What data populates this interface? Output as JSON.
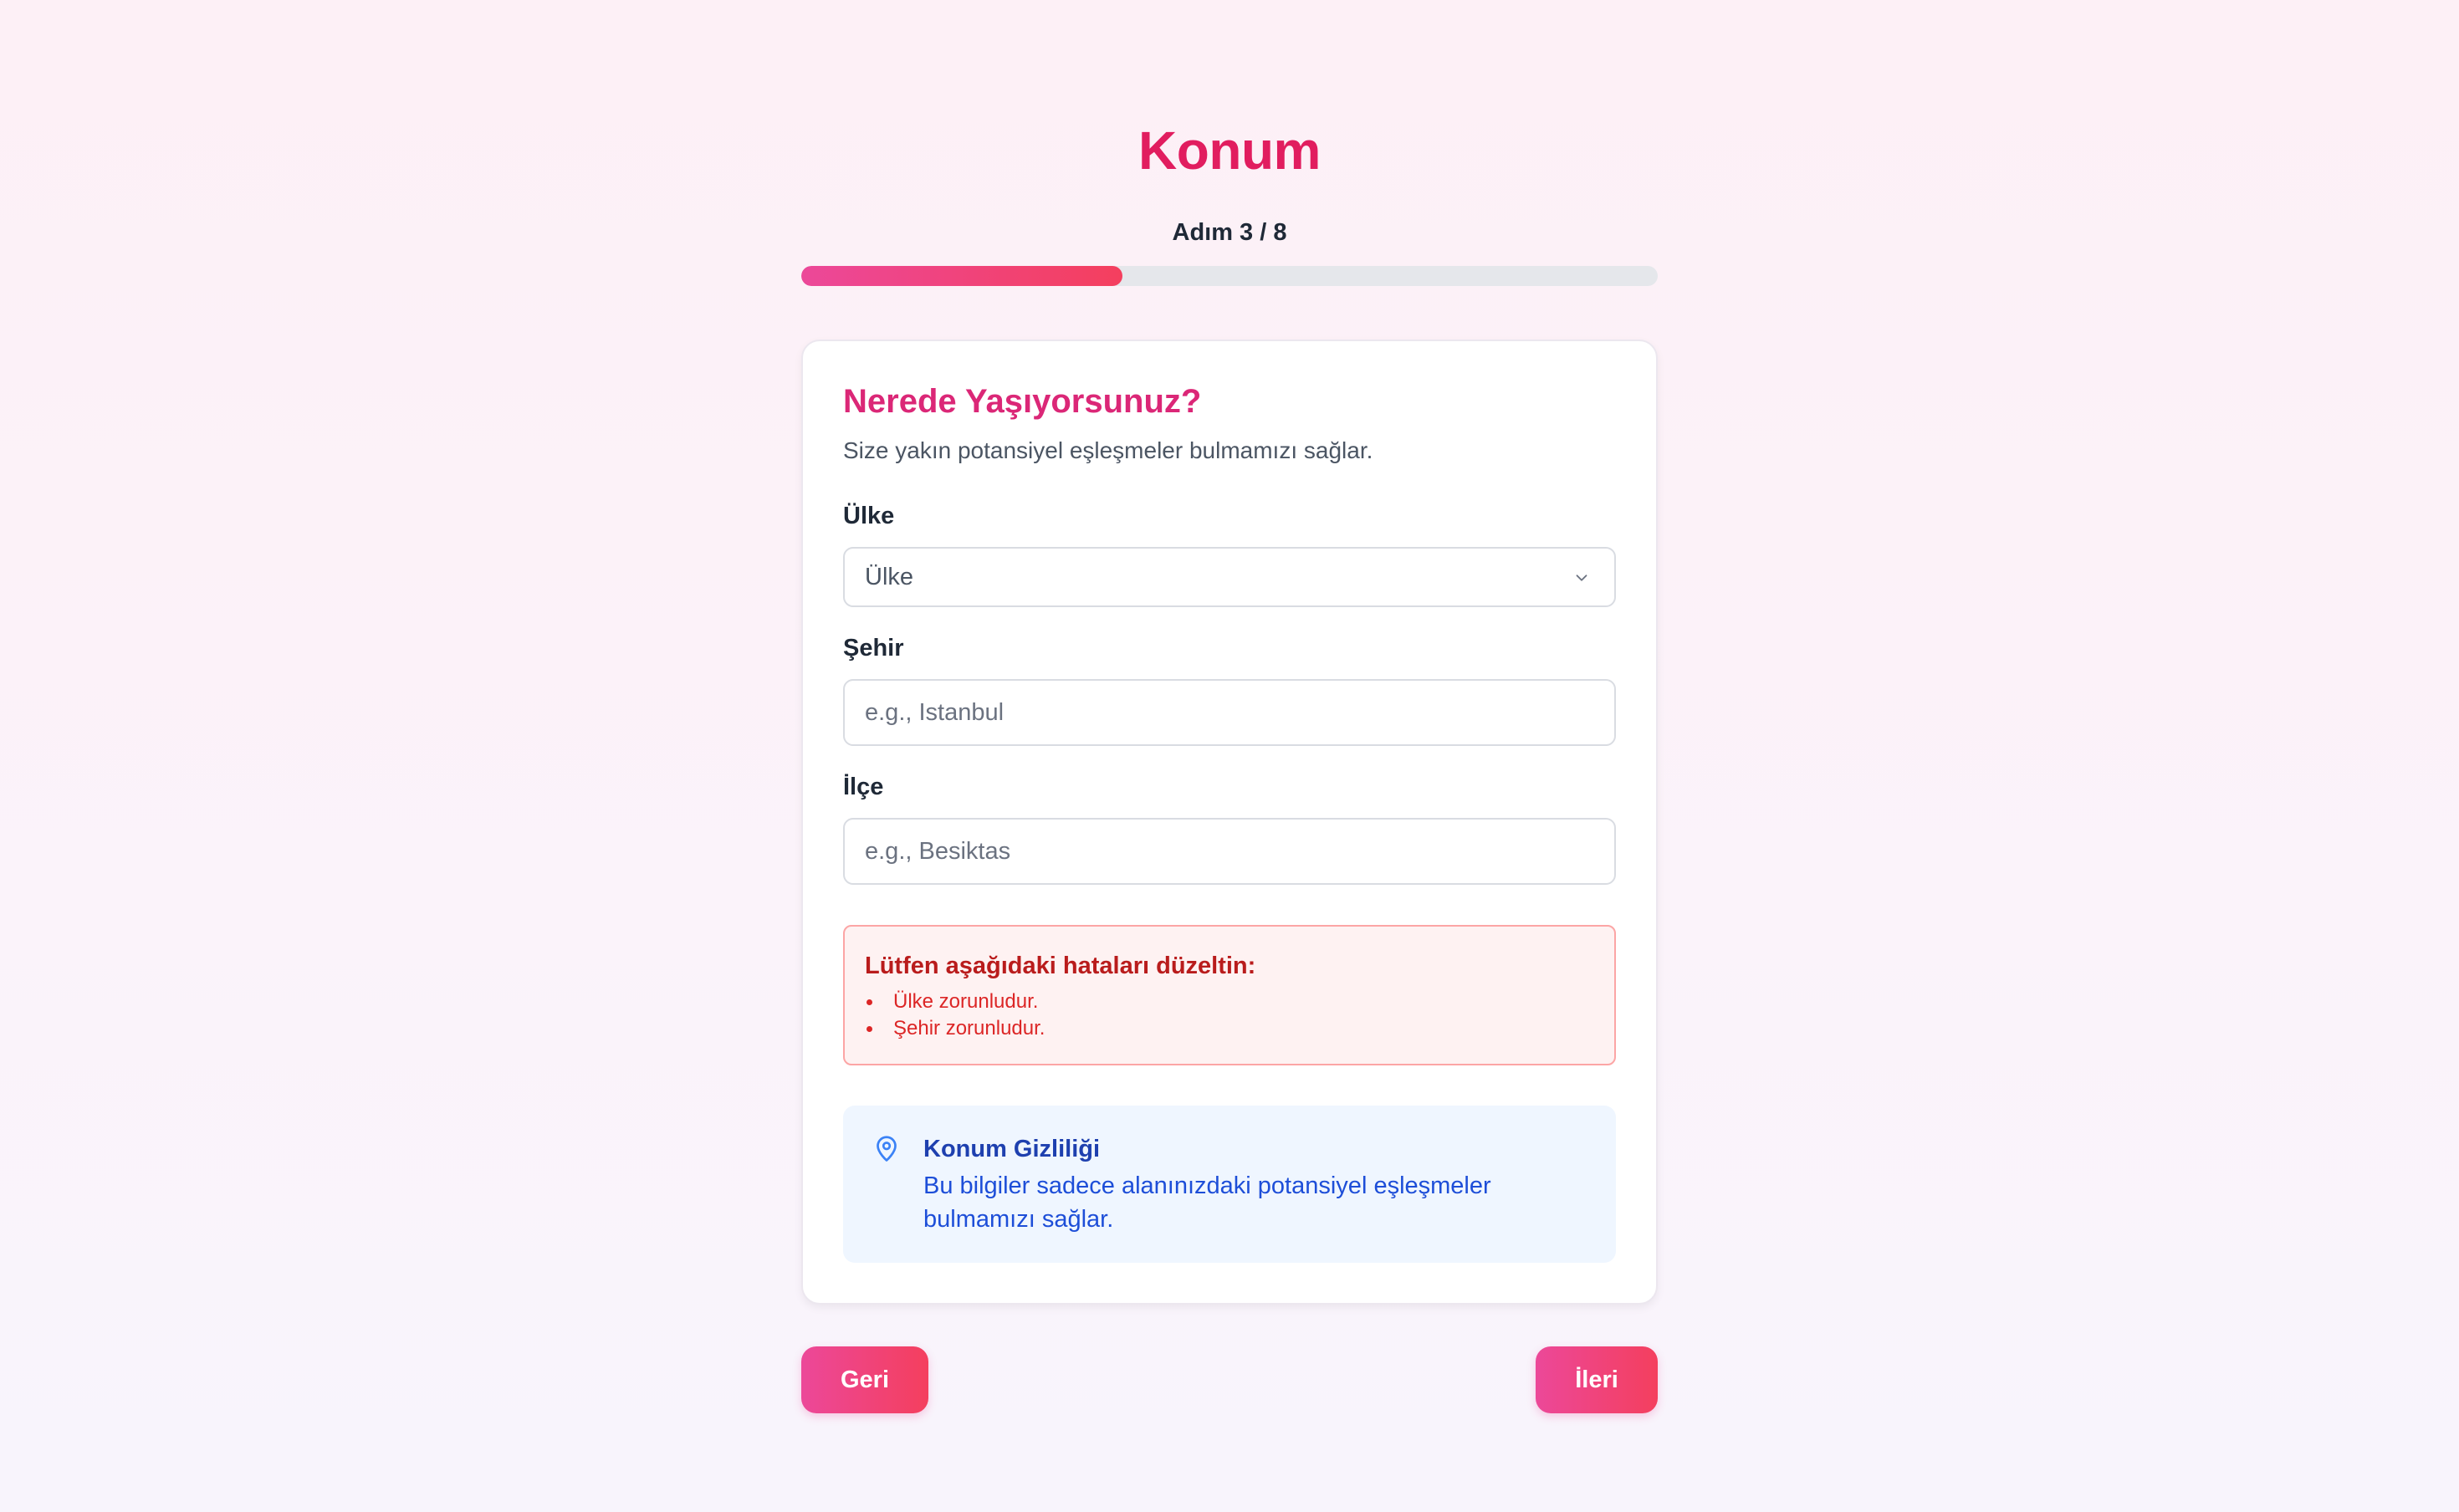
{
  "header": {
    "title": "Konum",
    "step_label": "Adım 3 / 8",
    "progress_fraction": 0.375
  },
  "card": {
    "title": "Nerede Yaşıyorsunuz?",
    "subtitle": "Size yakın potansiyel eşleşmeler bulmamızı sağlar.",
    "country": {
      "label": "Ülke",
      "selected_value": "Ülke"
    },
    "city": {
      "label": "Şehir",
      "placeholder": "e.g., Istanbul",
      "value": ""
    },
    "district": {
      "label": "İlçe",
      "placeholder": "e.g., Besiktas",
      "value": ""
    },
    "errors": {
      "title": "Lütfen aşağıdaki hataları düzeltin:",
      "items": [
        "Ülke zorunludur.",
        "Şehir zorunludur."
      ]
    },
    "privacy": {
      "icon": "map-pin-icon",
      "title": "Konum Gizliliği",
      "body": "Bu bilgiler sadece alanınızdaki potansiyel eşleşmeler bulmamızı sağlar."
    }
  },
  "nav": {
    "back_label": "Geri",
    "next_label": "İleri"
  },
  "colors": {
    "accent": "#e11d5f",
    "gradient_start": "#ec4899",
    "gradient_end": "#f43f5e",
    "error": "#dc2626",
    "info": "#1d4ed8"
  }
}
